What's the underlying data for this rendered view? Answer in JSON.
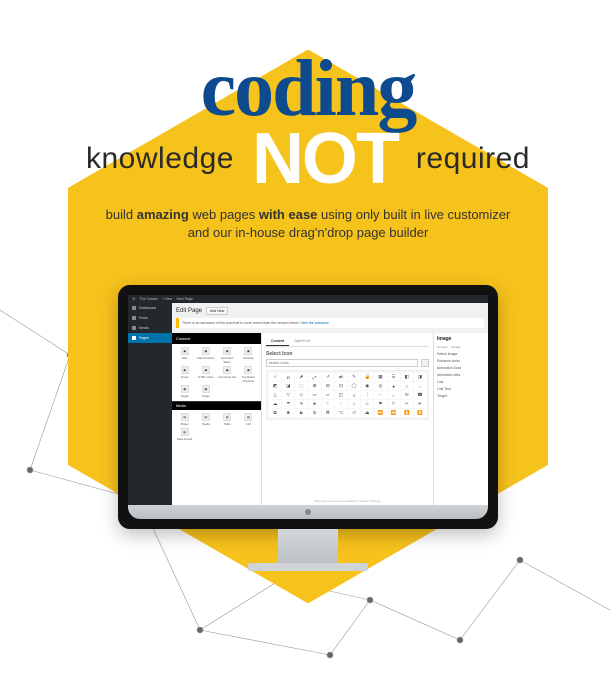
{
  "hero": {
    "coding": "coding",
    "knowledge": "knowledge",
    "not": "NOT",
    "required": "required",
    "sub_prefix": "build ",
    "sub_amazing": "amazing",
    "sub_mid1": " web pages ",
    "sub_withease": "with ease",
    "sub_mid2": " using only built in live customizer",
    "sub_line2": "and our in-house drag'n'drop page builder"
  },
  "wp": {
    "toolbar": {
      "site": "The Creator",
      "plus": "+ New",
      "view": "View Page"
    },
    "menu": {
      "dashboard": "Dashboard",
      "posts": "Posts",
      "media": "Media",
      "pages": "Pages"
    },
    "page": {
      "title": "Edit Page",
      "addnew": "Add New",
      "notice_text": "There is an autosave of this post that is more recent than the version below. ",
      "notice_link": "View the autosave"
    }
  },
  "builder": {
    "left": {
      "tab": "Content",
      "items": [
        "Tabs",
        "Sale Products",
        "Accordion Slider",
        "Verticaly",
        "Vimeo",
        "HTML Video",
        "Unordered List",
        "Top Rated Products",
        "Toggle",
        "Image"
      ],
      "group_media": "Media",
      "media_items": [
        "Player",
        "Media",
        "Table",
        "123",
        "Date Accord"
      ]
    },
    "mid": {
      "tab_content": "Content",
      "tab_style": "Style/Font",
      "heading": "Select Icon",
      "search_placeholder": "search icons",
      "footnote": "More icon sets can be enabled in Creator Settings"
    },
    "right": {
      "heading": "Image",
      "tab_content": "Content",
      "tab_design": "Design",
      "fields": [
        "Select Image",
        "Entrance Anim",
        "Animation Dura",
        "Animation dela",
        "Link",
        "Link Text",
        "Target"
      ]
    }
  },
  "icons_unicode": [
    "☆",
    "⎌",
    "⬈",
    "⤢",
    "↗",
    "⇄",
    "✎",
    "🔒",
    "▦",
    "☰",
    "◧",
    "◨",
    "◩",
    "◪",
    "⬚",
    "⊞",
    "⊟",
    "⊡",
    "◯",
    "◉",
    "◎",
    "●",
    "○",
    "◌",
    "△",
    "▽",
    "◇",
    "▭",
    "▱",
    "◫",
    "≡",
    "⋮",
    "⋯",
    "⌂",
    "✉",
    "☎",
    "☁",
    "☂",
    "☀",
    "★",
    "♡",
    "♢",
    "♤",
    "♧",
    "⚑",
    "⚐",
    "✂",
    "✈",
    "✿",
    "❀",
    "☯",
    "☮",
    "⌘",
    "⌥",
    "⏎",
    "⏏",
    "⏩",
    "⏪",
    "⏫",
    "⏬"
  ]
}
